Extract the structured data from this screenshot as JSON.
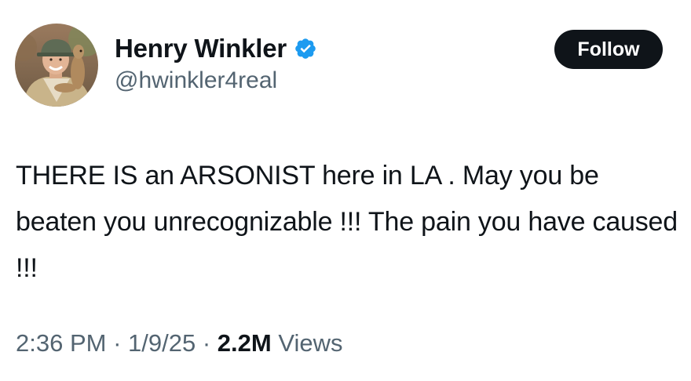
{
  "author": {
    "display_name": "Henry Winkler",
    "handle": "@hwinkler4real",
    "verified": true,
    "verified_badge_icon": "verified-badge-icon",
    "verified_color": "#1d9bf0"
  },
  "follow_button": {
    "label": "Follow",
    "background": "#0f1419",
    "text_color": "#ffffff"
  },
  "tweet": {
    "text": "THERE IS an ARSONIST here in LA . May you be beaten you unrecognizable !!! The pain you have caused !!!"
  },
  "meta": {
    "time": "2:36 PM",
    "separator": " · ",
    "date": "1/9/25",
    "views_count": "2.2M",
    "views_label": "Views"
  }
}
